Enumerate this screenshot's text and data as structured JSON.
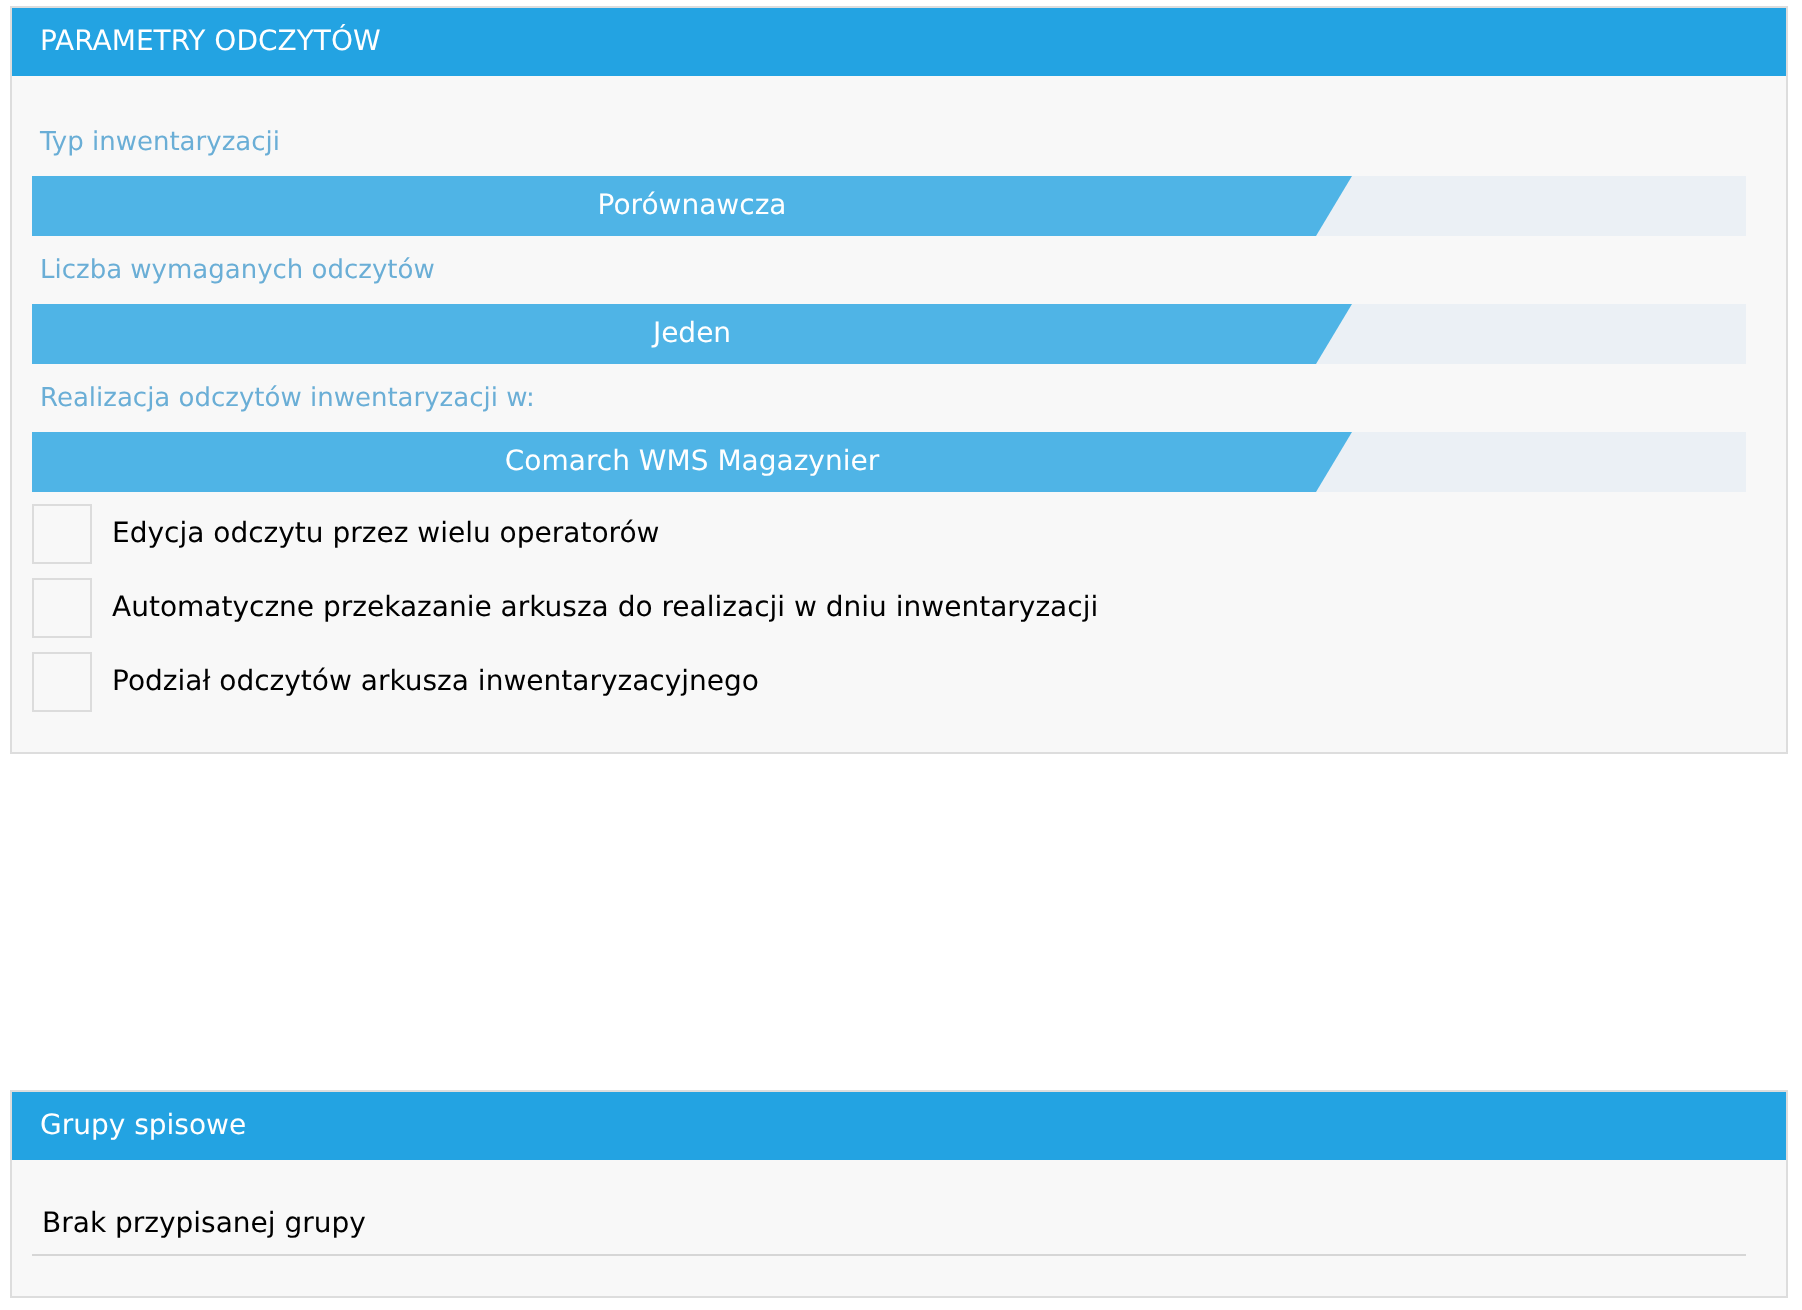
{
  "panels": [
    {
      "title": "PARAMETRY ODCZYTÓW",
      "kind": "settings",
      "selectors": [
        {
          "label": "Typ inwentaryzacji",
          "value": "Porównawcza"
        },
        {
          "label": "Liczba wymaganych odczytów",
          "value": "Jeden"
        },
        {
          "label": "Realizacja odczytów inwentaryzacji w:",
          "value": "Comarch WMS Magazynier"
        }
      ],
      "options": [
        {
          "label": "Edycja odczytu przez wielu operatorów",
          "checked": false
        },
        {
          "label": "Automatyczne przekazanie arkusza do realizacji w dniu inwentaryzacji",
          "checked": false
        },
        {
          "label": "Podział odczytów arkusza inwentaryzacyjnego",
          "checked": false
        }
      ]
    },
    {
      "title": "Grupy spisowe",
      "kind": "groups",
      "value": "Brak przypisanej grupy"
    }
  ]
}
